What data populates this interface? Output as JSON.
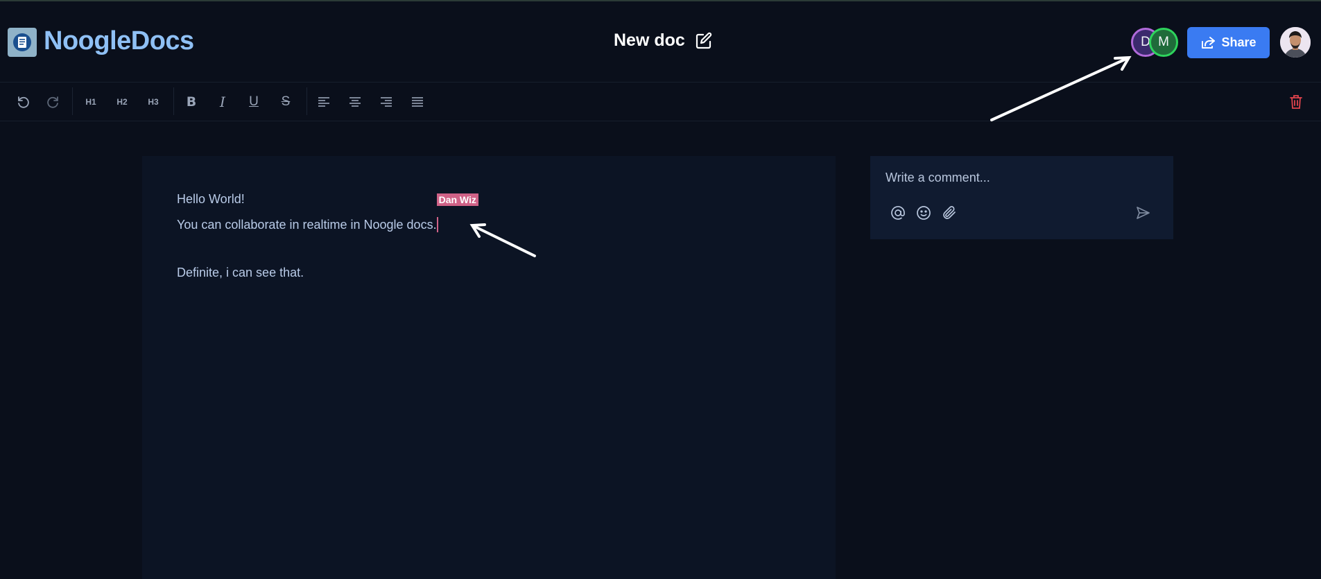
{
  "app": {
    "name": "NoogleDocs",
    "logo_icon": "document-icon"
  },
  "document": {
    "title": "New doc"
  },
  "collaborators": [
    {
      "initial": "D",
      "ring_color": "#b06ad9"
    },
    {
      "initial": "M",
      "ring_color": "#2ed35c"
    }
  ],
  "header": {
    "share_label": "Share"
  },
  "toolbar": {
    "undo_icon": "undo-icon",
    "redo_icon": "redo-icon",
    "h1": "H1",
    "h2": "H2",
    "h3": "H3",
    "bold": "B",
    "italic": "I",
    "underline": "U",
    "strike": "S",
    "delete_icon": "trash-icon"
  },
  "editor": {
    "lines": [
      "Hello World!",
      "You can collaborate in realtime in Noogle docs.",
      "",
      "Definite, i can see that."
    ],
    "remote_cursor": {
      "user": "Dan Wiz",
      "color": "#d06287"
    }
  },
  "comment": {
    "placeholder": "Write a comment..."
  },
  "colors": {
    "accent": "#3a7bf2",
    "brand": "#8fc0f5",
    "danger": "#e2444d"
  }
}
